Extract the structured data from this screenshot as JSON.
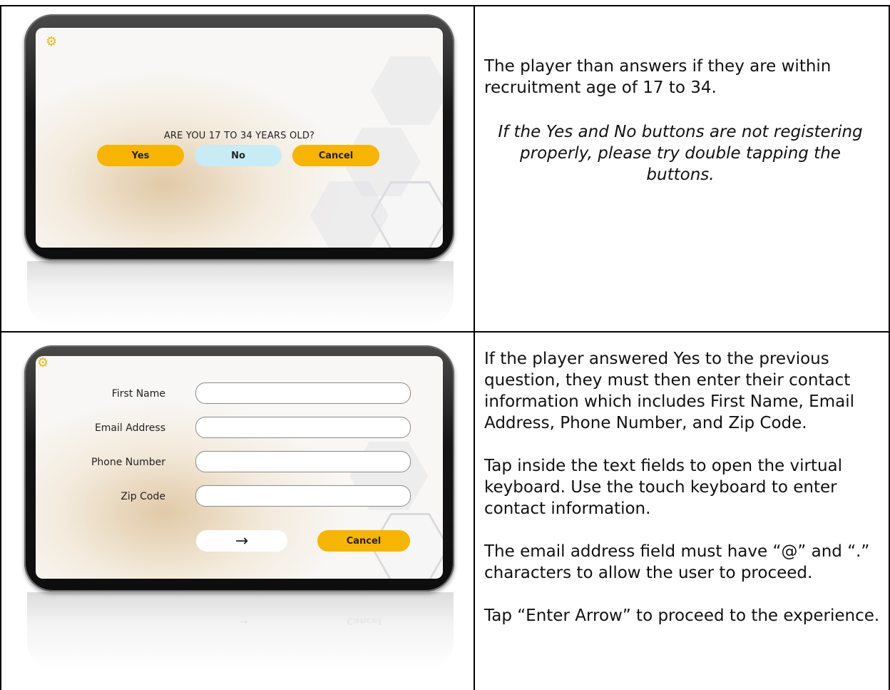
{
  "top_row": {
    "screen": {
      "question": "ARE YOU 17 TO 34 YEARS OLD?",
      "yes_label": "Yes",
      "no_label": "No",
      "cancel_label": "Cancel"
    },
    "text": {
      "para1": "The player than answers if they are within recruitment age of 17 to 34.",
      "para2": "If the Yes and No buttons are not registering properly, please try double tapping the buttons."
    }
  },
  "bottom_row": {
    "screen": {
      "labels": [
        "First Name",
        "Email Address",
        "Phone Number",
        "Zip Code"
      ],
      "enter_arrow": "→",
      "cancel_label": "Cancel",
      "reflection_cancel": "Cancel"
    },
    "text": {
      "para1": "If the player answered Yes to the previous question, they must then enter their contact information which includes First Name, Email Address, Phone Number, and Zip Code.",
      "para2": "Tap inside the text fields to open the virtual keyboard. Use the touch keyboard to enter contact information.",
      "para3": "The email address field must have “@” and “.” characters to allow the user to proceed.",
      "para4": "Tap “Enter Arrow” to proceed to the experience."
    }
  },
  "colors": {
    "accent_yellow": "#f7b500",
    "no_button_blue": "#c8ecf6",
    "gear": "#f2b705"
  },
  "icons": {
    "settings": "gear-icon",
    "enter": "arrow-right-icon"
  }
}
